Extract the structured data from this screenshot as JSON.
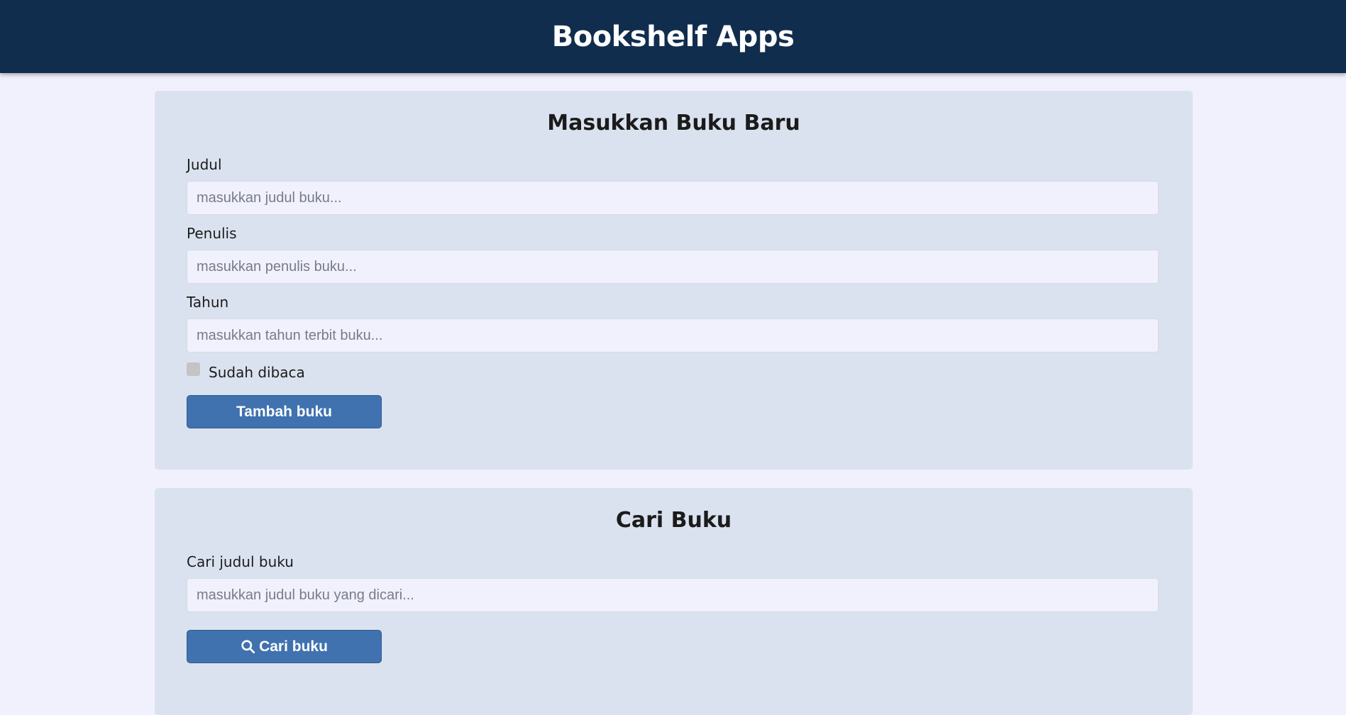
{
  "header": {
    "title": "Bookshelf Apps"
  },
  "add_book": {
    "title": "Masukkan Buku Baru",
    "title_field": {
      "label": "Judul",
      "placeholder": "masukkan judul buku...",
      "value": ""
    },
    "author_field": {
      "label": "Penulis",
      "placeholder": "masukkan penulis buku...",
      "value": ""
    },
    "year_field": {
      "label": "Tahun",
      "placeholder": "masukkan tahun terbit buku...",
      "value": ""
    },
    "is_complete": {
      "label": "Sudah dibaca",
      "checked": false
    },
    "submit_label": "Tambah buku"
  },
  "search_book": {
    "title": "Cari Buku",
    "search_field": {
      "label": "Cari judul buku",
      "placeholder": "masukkan judul buku yang dicari...",
      "value": ""
    },
    "submit_label": "Cari buku",
    "submit_icon": "search-icon"
  },
  "colors": {
    "header_bg": "#112d4e",
    "page_bg": "#f0f1fc",
    "card_bg": "#dbe2ef",
    "button_bg": "#3f72af"
  }
}
